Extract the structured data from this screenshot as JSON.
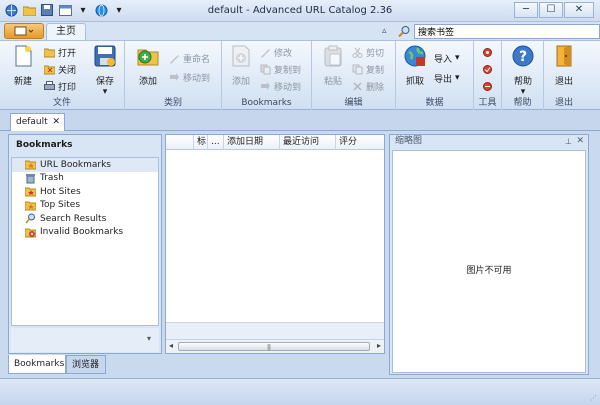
{
  "window": {
    "title": "default - Advanced URL Catalog 2.36",
    "minimize": "─",
    "maximize": "☐",
    "close": "✕"
  },
  "tabs": {
    "home": "主页"
  },
  "search": {
    "value": "搜索书签"
  },
  "ribbon": {
    "file": {
      "label": "文件",
      "new": "新建",
      "open": "打开",
      "close": "关闭",
      "print": "打印",
      "save": "保存"
    },
    "category": {
      "label": "类别",
      "add": "添加",
      "rename": "重命名",
      "move": "移动到"
    },
    "bookmarks": {
      "label": "Bookmarks",
      "add": "添加",
      "edit": "修改",
      "copy": "复制到",
      "move": "移动到"
    },
    "edit": {
      "label": "编辑",
      "paste": "粘贴",
      "cut": "剪切",
      "copy": "复制",
      "delete": "删除"
    },
    "data": {
      "label": "数据",
      "capture": "抓取",
      "import": "导入",
      "export": "导出"
    },
    "tools": {
      "label": "工具"
    },
    "help": {
      "label": "帮助",
      "help": "帮助"
    },
    "exit": {
      "label": "退出",
      "exit": "退出"
    }
  },
  "doc_tab": {
    "label": "default"
  },
  "left_panel": {
    "title": "Bookmarks",
    "items": [
      {
        "label": "URL Bookmarks",
        "icon": "folder-star-icon"
      },
      {
        "label": "Trash",
        "icon": "trash-icon"
      },
      {
        "label": "Hot Sites",
        "icon": "folder-star-icon"
      },
      {
        "label": "Top Sites",
        "icon": "folder-star-icon"
      },
      {
        "label": "Search Results",
        "icon": "search-results-icon"
      },
      {
        "label": "Invalid Bookmarks",
        "icon": "invalid-icon"
      }
    ]
  },
  "list": {
    "columns": [
      "标",
      "...",
      "添加日期",
      "最近访问",
      "评分"
    ]
  },
  "bottom_tabs": {
    "bookmarks": "Bookmarks",
    "browser": "浏览器"
  },
  "thumbnail": {
    "title": "缩略图",
    "no_image": "图片不可用"
  },
  "colors": {
    "accent": "#e59a2d",
    "ribbon": "#dbe7f5",
    "frame": "#c9d9ee"
  }
}
